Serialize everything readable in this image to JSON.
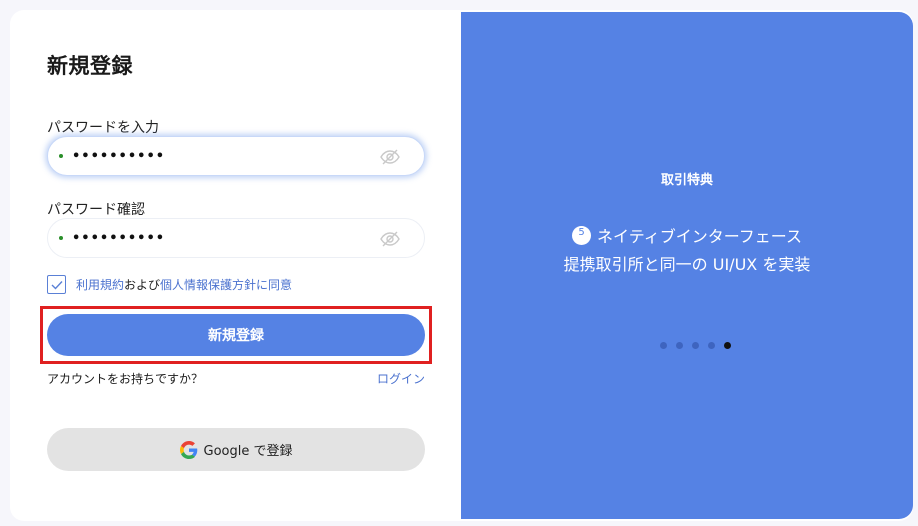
{
  "form": {
    "title": "新規登録",
    "password_label": "パスワードを入力",
    "password_value": "••••••••••",
    "confirm_label": "パスワード確認",
    "confirm_value": "••••••••••",
    "agree_link1": "利用規約",
    "agree_mid": "および",
    "agree_link2": "個人情報保護方針",
    "agree_tail": "に同意",
    "agree_checked": true,
    "submit_label": "新規登録",
    "has_account_text": "アカウントをお持ちですか？",
    "login_link": "ログイン",
    "google_label": "Google で登録"
  },
  "promo": {
    "heading": "取引特典",
    "badge_number": "5",
    "line1": "ネイティブインターフェース",
    "line2": "提携取引所と同一の UI/UX を実装",
    "dots_total": 5,
    "dots_active_index": 4
  },
  "colors": {
    "primary": "#5582e4",
    "link": "#4b72cf",
    "highlight": "#e02020",
    "input_indicator": "#2a8f2a"
  },
  "icons": [
    "eye-off-icon",
    "check-icon",
    "google-icon"
  ]
}
